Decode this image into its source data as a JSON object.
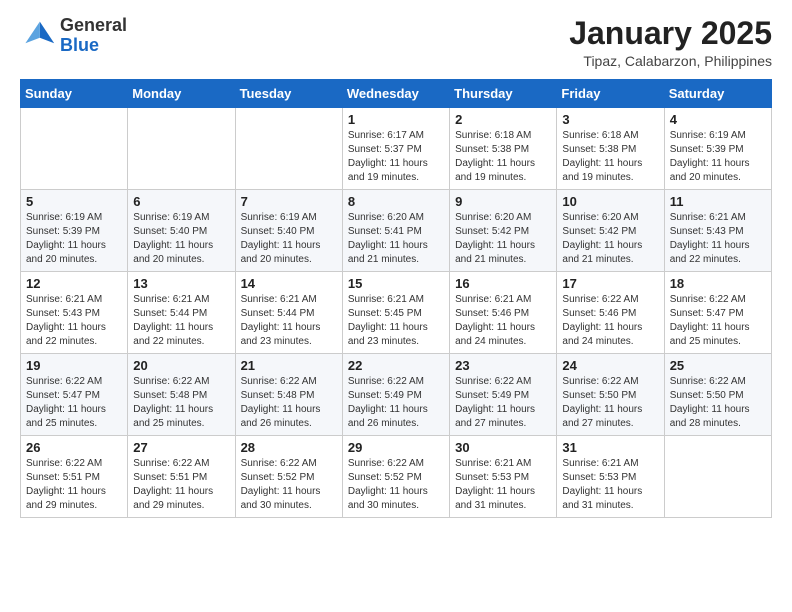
{
  "header": {
    "logo_general": "General",
    "logo_blue": "Blue",
    "month_title": "January 2025",
    "subtitle": "Tipaz, Calabarzon, Philippines"
  },
  "days_of_week": [
    "Sunday",
    "Monday",
    "Tuesday",
    "Wednesday",
    "Thursday",
    "Friday",
    "Saturday"
  ],
  "weeks": [
    [
      {
        "day": "",
        "info": ""
      },
      {
        "day": "",
        "info": ""
      },
      {
        "day": "",
        "info": ""
      },
      {
        "day": "1",
        "info": "Sunrise: 6:17 AM\nSunset: 5:37 PM\nDaylight: 11 hours and 19 minutes."
      },
      {
        "day": "2",
        "info": "Sunrise: 6:18 AM\nSunset: 5:38 PM\nDaylight: 11 hours and 19 minutes."
      },
      {
        "day": "3",
        "info": "Sunrise: 6:18 AM\nSunset: 5:38 PM\nDaylight: 11 hours and 19 minutes."
      },
      {
        "day": "4",
        "info": "Sunrise: 6:19 AM\nSunset: 5:39 PM\nDaylight: 11 hours and 20 minutes."
      }
    ],
    [
      {
        "day": "5",
        "info": "Sunrise: 6:19 AM\nSunset: 5:39 PM\nDaylight: 11 hours and 20 minutes."
      },
      {
        "day": "6",
        "info": "Sunrise: 6:19 AM\nSunset: 5:40 PM\nDaylight: 11 hours and 20 minutes."
      },
      {
        "day": "7",
        "info": "Sunrise: 6:19 AM\nSunset: 5:40 PM\nDaylight: 11 hours and 20 minutes."
      },
      {
        "day": "8",
        "info": "Sunrise: 6:20 AM\nSunset: 5:41 PM\nDaylight: 11 hours and 21 minutes."
      },
      {
        "day": "9",
        "info": "Sunrise: 6:20 AM\nSunset: 5:42 PM\nDaylight: 11 hours and 21 minutes."
      },
      {
        "day": "10",
        "info": "Sunrise: 6:20 AM\nSunset: 5:42 PM\nDaylight: 11 hours and 21 minutes."
      },
      {
        "day": "11",
        "info": "Sunrise: 6:21 AM\nSunset: 5:43 PM\nDaylight: 11 hours and 22 minutes."
      }
    ],
    [
      {
        "day": "12",
        "info": "Sunrise: 6:21 AM\nSunset: 5:43 PM\nDaylight: 11 hours and 22 minutes."
      },
      {
        "day": "13",
        "info": "Sunrise: 6:21 AM\nSunset: 5:44 PM\nDaylight: 11 hours and 22 minutes."
      },
      {
        "day": "14",
        "info": "Sunrise: 6:21 AM\nSunset: 5:44 PM\nDaylight: 11 hours and 23 minutes."
      },
      {
        "day": "15",
        "info": "Sunrise: 6:21 AM\nSunset: 5:45 PM\nDaylight: 11 hours and 23 minutes."
      },
      {
        "day": "16",
        "info": "Sunrise: 6:21 AM\nSunset: 5:46 PM\nDaylight: 11 hours and 24 minutes."
      },
      {
        "day": "17",
        "info": "Sunrise: 6:22 AM\nSunset: 5:46 PM\nDaylight: 11 hours and 24 minutes."
      },
      {
        "day": "18",
        "info": "Sunrise: 6:22 AM\nSunset: 5:47 PM\nDaylight: 11 hours and 25 minutes."
      }
    ],
    [
      {
        "day": "19",
        "info": "Sunrise: 6:22 AM\nSunset: 5:47 PM\nDaylight: 11 hours and 25 minutes."
      },
      {
        "day": "20",
        "info": "Sunrise: 6:22 AM\nSunset: 5:48 PM\nDaylight: 11 hours and 25 minutes."
      },
      {
        "day": "21",
        "info": "Sunrise: 6:22 AM\nSunset: 5:48 PM\nDaylight: 11 hours and 26 minutes."
      },
      {
        "day": "22",
        "info": "Sunrise: 6:22 AM\nSunset: 5:49 PM\nDaylight: 11 hours and 26 minutes."
      },
      {
        "day": "23",
        "info": "Sunrise: 6:22 AM\nSunset: 5:49 PM\nDaylight: 11 hours and 27 minutes."
      },
      {
        "day": "24",
        "info": "Sunrise: 6:22 AM\nSunset: 5:50 PM\nDaylight: 11 hours and 27 minutes."
      },
      {
        "day": "25",
        "info": "Sunrise: 6:22 AM\nSunset: 5:50 PM\nDaylight: 11 hours and 28 minutes."
      }
    ],
    [
      {
        "day": "26",
        "info": "Sunrise: 6:22 AM\nSunset: 5:51 PM\nDaylight: 11 hours and 29 minutes."
      },
      {
        "day": "27",
        "info": "Sunrise: 6:22 AM\nSunset: 5:51 PM\nDaylight: 11 hours and 29 minutes."
      },
      {
        "day": "28",
        "info": "Sunrise: 6:22 AM\nSunset: 5:52 PM\nDaylight: 11 hours and 30 minutes."
      },
      {
        "day": "29",
        "info": "Sunrise: 6:22 AM\nSunset: 5:52 PM\nDaylight: 11 hours and 30 minutes."
      },
      {
        "day": "30",
        "info": "Sunrise: 6:21 AM\nSunset: 5:53 PM\nDaylight: 11 hours and 31 minutes."
      },
      {
        "day": "31",
        "info": "Sunrise: 6:21 AM\nSunset: 5:53 PM\nDaylight: 11 hours and 31 minutes."
      },
      {
        "day": "",
        "info": ""
      }
    ]
  ]
}
